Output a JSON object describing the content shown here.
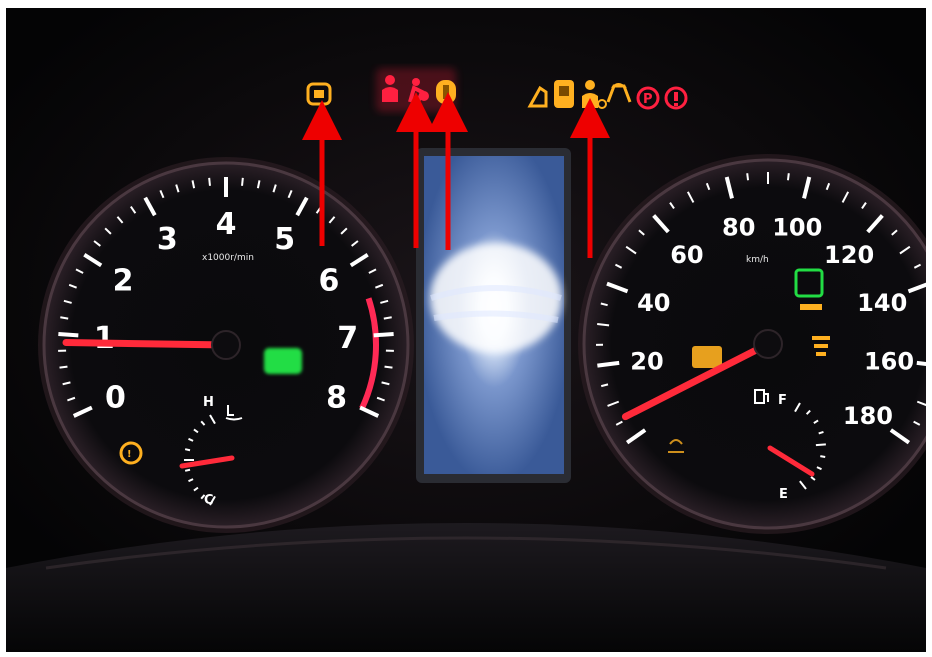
{
  "tachometer": {
    "numerals": [
      "0",
      "1",
      "2",
      "3",
      "4",
      "5",
      "6",
      "7",
      "8"
    ],
    "unit": "x1000r/min",
    "reading": 0.9,
    "redline_from": 6.5
  },
  "speedometer": {
    "numerals": [
      "20",
      "40",
      "60",
      "80",
      "100",
      "120",
      "140",
      "160",
      "180"
    ],
    "unit": "km/h",
    "reading": 0
  },
  "temperature_gauge": {
    "labels": {
      "hot": "H",
      "cold": "C"
    }
  },
  "fuel_gauge": {
    "labels": {
      "full": "F",
      "empty": "E"
    }
  },
  "colors": {
    "needle": "#ff2a3a",
    "scale_white": "#ffffff",
    "redline": "#ff2a55",
    "warning_amber": "#ffb020",
    "warning_red": "#ff2040",
    "indicator_green": "#22dd44",
    "annotation_arrow": "#ee0000",
    "center_display": "#3f5f9e"
  },
  "warning_lights": [
    {
      "icon": "brake-system-icon",
      "color": "amber"
    },
    {
      "icon": "seatbelt-reminder-icon",
      "color": "red"
    },
    {
      "icon": "airbag-icon",
      "color": "red"
    },
    {
      "icon": "engine-oil-icon",
      "color": "amber"
    },
    {
      "icon": "door-open-icon",
      "color": "amber"
    },
    {
      "icon": "trunk-icon",
      "color": "amber"
    },
    {
      "icon": "passenger-seatbelt-icon",
      "color": "amber"
    },
    {
      "icon": "vsc-icon",
      "color": "amber"
    },
    {
      "icon": "parking-brake-icon",
      "color": "red"
    },
    {
      "icon": "brake-warning-icon",
      "color": "red"
    }
  ],
  "annotations": {
    "arrow_count": 4
  }
}
